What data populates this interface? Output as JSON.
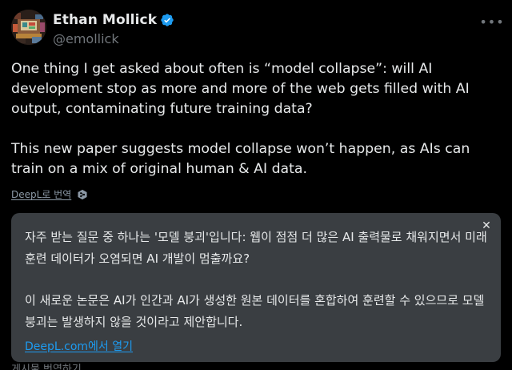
{
  "author": {
    "display_name": "Ethan Mollick",
    "handle": "@emollick",
    "verified": true,
    "verified_color": "#1d9bf0",
    "avatar_icon": "pixel-art-avatar"
  },
  "more_icon": "more-dots-icon",
  "tweet": {
    "paragraph_1": "One thing I get asked about often is “model collapse”: will AI development stop as more and more of the web gets filled with AI output, contaminating future training data?",
    "paragraph_2": "This new paper suggests model collapse won’t happen, as AIs can train on a mix of original human & AI data."
  },
  "translate_bar": {
    "link_label": "DeepL로 번역",
    "logo_icon": "deepl-logo-icon"
  },
  "translation": {
    "paragraph_1": "자주 받는 질문 중 하나는 '모델 붕괴'입니다: 웹이 점점 더 많은 AI 출력물로 채워지면서 미래 훈련 데이터가 오염되면 AI 개발이 멈출까요?",
    "paragraph_2": "이 새로운 논문은 AI가 인간과 AI가 생성한 원본 데이터를 혼합하여 훈련할 수 있으므로 모델 붕괴는 발생하지 않을 것이라고 제안합니다.",
    "open_link_label": "DeepL.com에서 열기",
    "close_icon": "close-icon"
  },
  "footer": {
    "translate_post_label": "게시물 번역하기"
  },
  "colors": {
    "background": "#000000",
    "text": "#e7e9ea",
    "muted": "#71767b",
    "accent": "#1d9bf0",
    "translation_box": "#3a3e42"
  }
}
